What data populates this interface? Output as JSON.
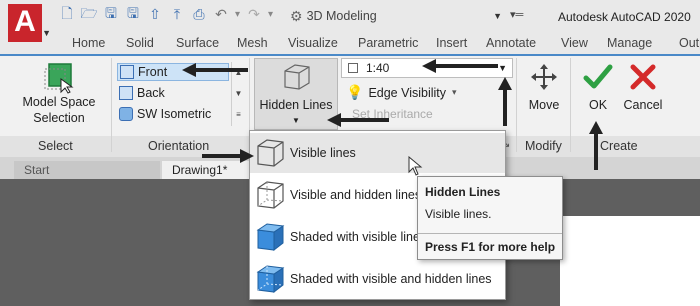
{
  "app": {
    "logo_letter": "A",
    "workspace": "3D Modeling",
    "title": "Autodesk AutoCAD 2020"
  },
  "ribbon_tabs": [
    "Home",
    "Solid",
    "Surface",
    "Mesh",
    "Visualize",
    "Parametric",
    "Insert",
    "Annotate",
    "View",
    "Manage",
    "Outp"
  ],
  "ribbon": {
    "model_space_selection": "Model Space Selection",
    "model_space_line1": "Model Space",
    "model_space_line2": "Selection",
    "orientation_items": [
      "Front",
      "Back",
      "SW Isometric"
    ],
    "hidden_lines": "Hidden Lines",
    "scale": "1:40",
    "edge_visibility": "Edge Visibility",
    "set_inheritance": "Set Inheritance",
    "move": "Move",
    "ok": "OK",
    "cancel": "Cancel",
    "panels": {
      "select": "Select",
      "orientation": "Orientation",
      "modify": "Modify",
      "create": "Create"
    }
  },
  "doc_tabs": {
    "start": "Start",
    "drawing": "Drawing1*"
  },
  "hidden_lines_menu": {
    "items": [
      "Visible lines",
      "Visible and hidden lines",
      "Shaded with visible lines",
      "Shaded with visible and hidden lines"
    ],
    "hovered_index": 0
  },
  "tooltip": {
    "title": "Hidden Lines",
    "description": "Visible lines.",
    "help": "Press F1 for more help"
  },
  "colors": {
    "accent_blue": "#4a89c8",
    "ok_green": "#2ea043",
    "cancel_red": "#d42a2a",
    "logo_red": "#c9252c",
    "canvas_gray": "#5f5f5f"
  }
}
